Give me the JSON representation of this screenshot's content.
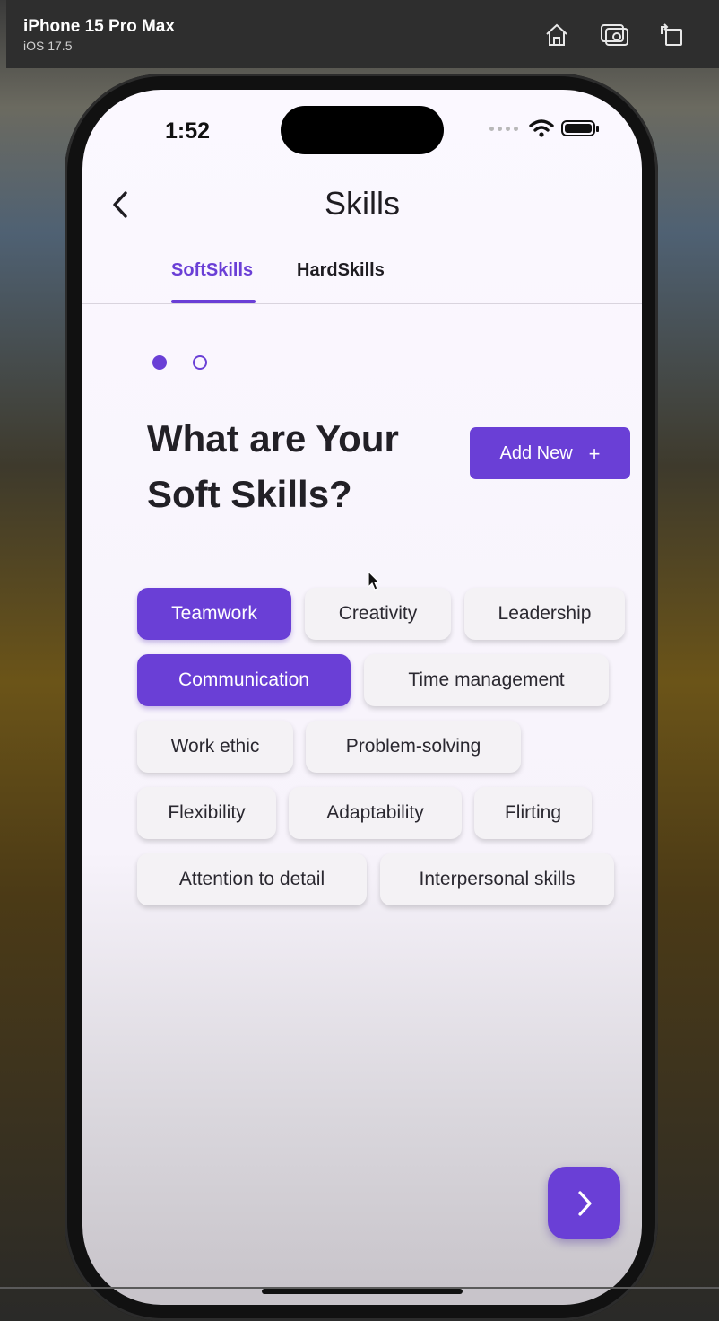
{
  "simulator": {
    "device": "iPhone 15 Pro Max",
    "os": "iOS 17.5",
    "icons": [
      "home-icon",
      "screenshot-icon",
      "rotate-icon"
    ]
  },
  "status_bar": {
    "time": "1:52"
  },
  "header": {
    "title": "Skills"
  },
  "tabs": [
    {
      "label": "SoftSkills",
      "active": true
    },
    {
      "label": "HardSkills",
      "active": false
    }
  ],
  "pager": {
    "total": 2,
    "current": 1
  },
  "heading": "What are Your Soft Skills?",
  "add_button": {
    "label": "Add New",
    "icon": "plus-icon"
  },
  "skills": [
    {
      "label": "Teamwork",
      "selected": true
    },
    {
      "label": "Creativity",
      "selected": false
    },
    {
      "label": "Leadership",
      "selected": false
    },
    {
      "label": "Communication",
      "selected": true
    },
    {
      "label": "Time management",
      "selected": false
    },
    {
      "label": "Work ethic",
      "selected": false
    },
    {
      "label": "Problem-solving",
      "selected": false
    },
    {
      "label": "Flexibility",
      "selected": false
    },
    {
      "label": "Adaptability",
      "selected": false
    },
    {
      "label": "Flirting",
      "selected": false
    },
    {
      "label": "Attention to detail",
      "selected": false
    },
    {
      "label": "Interpersonal skills",
      "selected": false
    }
  ],
  "colors": {
    "accent": "#6a3fd6",
    "chip_bg": "#f4f2f5"
  }
}
